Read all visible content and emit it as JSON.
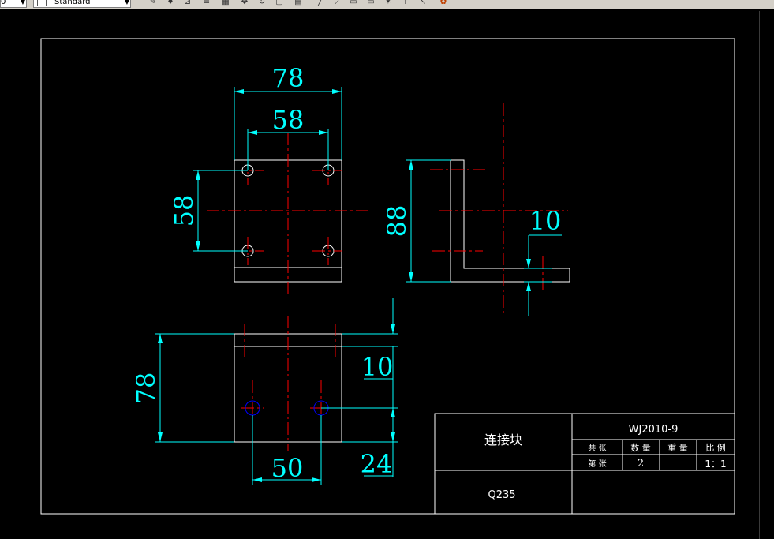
{
  "toolbar": {
    "layer_value": "0",
    "style_value": "Standard",
    "icons": [
      "text-style-icon",
      "pencil-icon",
      "paint-icon",
      "measure-icon",
      "align-icon",
      "grid-icon",
      "move-icon",
      "rotate-icon",
      "window-icon",
      "layer-icon",
      "line-icon",
      "polyline-icon",
      "rect-icon",
      "rect2-icon",
      "star-icon",
      "arrow-icon",
      "cursor-icon",
      "color-icon"
    ]
  },
  "drawing": {
    "dims": {
      "top_width": "78",
      "hole_spacing_x": "58",
      "hole_spacing_y": "58",
      "side_height": "88",
      "side_thickness": "10",
      "bottom_height": "78",
      "bottom_thickness": "10",
      "bottom_hole_spacing": "50",
      "bottom_hole_offset": "24"
    }
  },
  "title_block": {
    "part_name": "连接块",
    "drawing_number": "WJ2010-9",
    "total_label": "共  张",
    "quantity_label": "数 量",
    "weight_label": "重 量",
    "scale_label": "比 例",
    "sheet_label": "第  张",
    "quantity_value": "2",
    "scale_value": "1：1",
    "material": "Q235"
  },
  "colors": {
    "background": "#000000",
    "outline": "#ffffff",
    "dimension": "#00ffff",
    "centerline": "#ff0000",
    "hole_marker": "#0000ff"
  }
}
